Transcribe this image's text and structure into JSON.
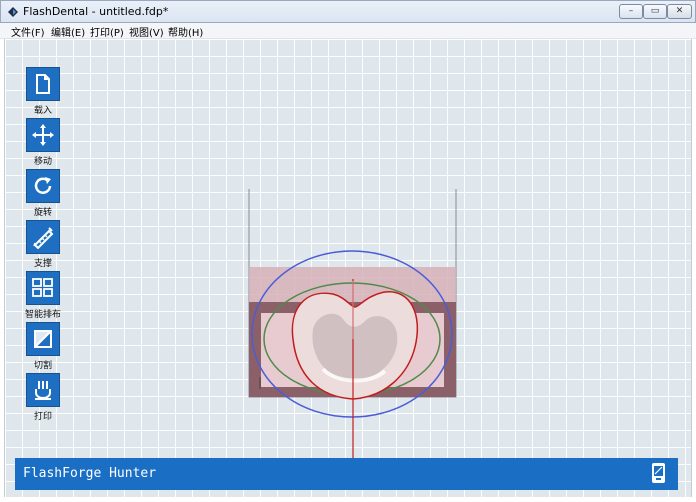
{
  "window": {
    "title": "FlashDental - untitled.fdp*",
    "min": "–",
    "max": "▭",
    "close": "✕"
  },
  "menu": [
    {
      "label": "文件(F)"
    },
    {
      "label": "编辑(E)"
    },
    {
      "label": "打印(P)"
    },
    {
      "label": "视图(V)"
    },
    {
      "label": "帮助(H)"
    }
  ],
  "tools": [
    {
      "label": "载入",
      "icon": "file-icon"
    },
    {
      "label": "移动",
      "icon": "move-icon"
    },
    {
      "label": "旋转",
      "icon": "rotate-icon"
    },
    {
      "label": "支撑",
      "icon": "support-icon"
    },
    {
      "label": "智能排布",
      "icon": "grid-layout-icon"
    },
    {
      "label": "切割",
      "icon": "cut-icon"
    },
    {
      "label": "打印",
      "icon": "print-icon"
    }
  ],
  "status": {
    "printer": "FlashForge Hunter"
  },
  "colors": {
    "accent": "#1e6fc2",
    "status_bar": "#1a6fc4"
  }
}
